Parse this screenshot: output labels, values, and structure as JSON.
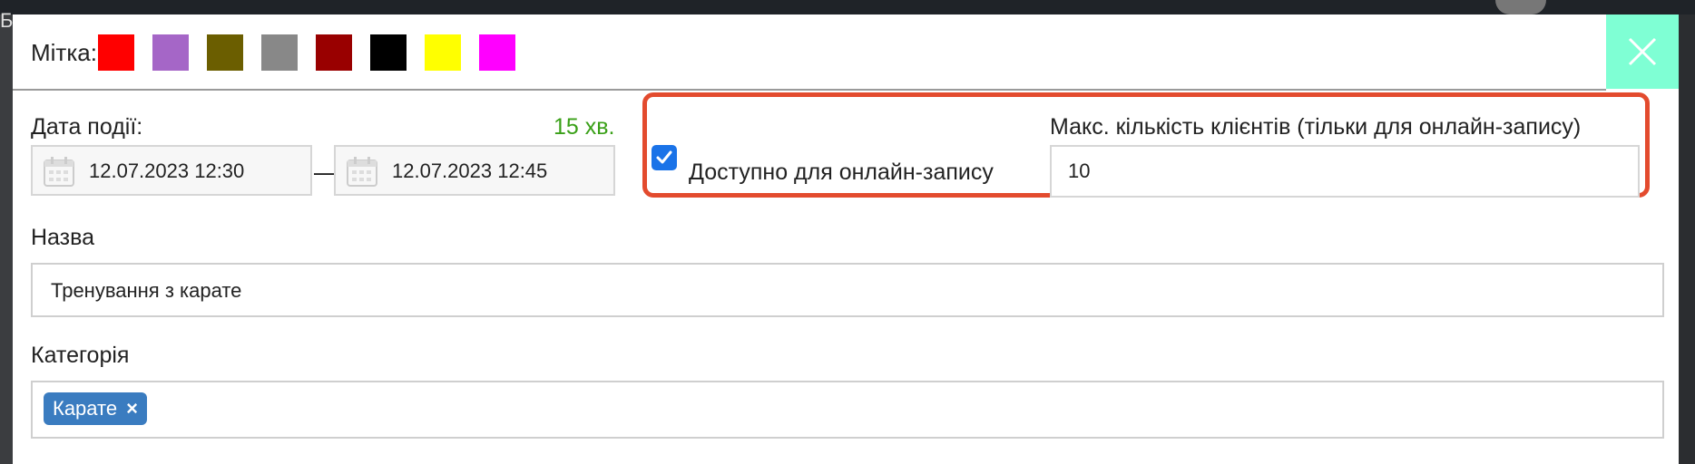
{
  "background": {
    "left_text": "Б"
  },
  "header": {
    "label": "Мітка:",
    "swatches": [
      {
        "name": "red",
        "color": "#ff0000"
      },
      {
        "name": "purple",
        "color": "#a566c7"
      },
      {
        "name": "olive",
        "color": "#6b5e00"
      },
      {
        "name": "gray",
        "color": "#888888"
      },
      {
        "name": "dark-red",
        "color": "#990000"
      },
      {
        "name": "black",
        "color": "#000000"
      },
      {
        "name": "yellow",
        "color": "#ffff00"
      },
      {
        "name": "magenta",
        "color": "#ff00ff"
      }
    ]
  },
  "event_date": {
    "label": "Дата події:",
    "duration": "15 хв.",
    "start": "12.07.2023 12:30",
    "separator": "—",
    "end": "12.07.2023 12:45"
  },
  "online": {
    "checked": true,
    "label": "Доступно для онлайн-запису",
    "max_label": "Макс. кількість клієнтів (тільки для онлайн-запису)",
    "max_value": "10"
  },
  "name_field": {
    "label": "Назва",
    "value": "Тренування з карате"
  },
  "category_field": {
    "label": "Категорія",
    "tag": "Карате",
    "tag_remove": "×"
  },
  "colors": {
    "close_bg": "#7fffd4",
    "highlight": "#e34b2e",
    "checkbox": "#1a73e8",
    "tag_bg": "#3a7cc0",
    "duration": "#3aa018"
  }
}
